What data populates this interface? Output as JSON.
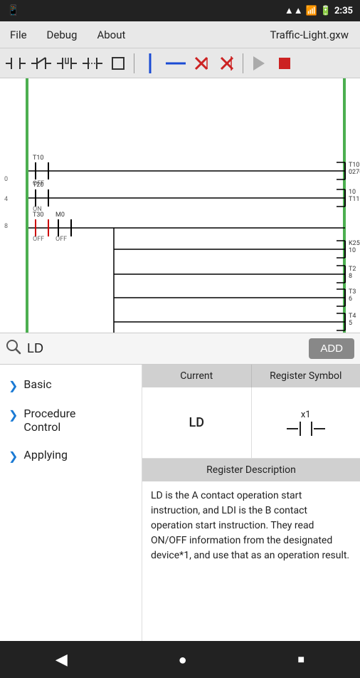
{
  "status_bar": {
    "time": "2:35",
    "battery_icon": "🔋",
    "signal_icon": "📶"
  },
  "menu_bar": {
    "items": [
      "File",
      "Debug",
      "About"
    ],
    "title": "Traffic-Light.gxw"
  },
  "toolbar": {
    "buttons": [
      {
        "name": "contact-no",
        "symbol": "⊣⊢",
        "label": "normally-open contact"
      },
      {
        "name": "contact-nc",
        "symbol": "⊣/⊢",
        "label": "normally-closed contact"
      },
      {
        "name": "contact-p",
        "symbol": "⊣↑⊢",
        "label": "positive pulse contact"
      },
      {
        "name": "contact-n",
        "symbol": "⊣↓⊢",
        "label": "negative pulse contact"
      },
      {
        "name": "box-symbol",
        "symbol": "[]",
        "label": "box"
      },
      {
        "name": "vertical-line",
        "symbol": "|",
        "label": "vertical line"
      },
      {
        "name": "horizontal-line",
        "symbol": "—",
        "label": "horizontal line"
      },
      {
        "name": "delete-x1",
        "symbol": "✕",
        "label": "delete 1"
      },
      {
        "name": "delete-x2",
        "symbol": "✕",
        "label": "delete 2"
      },
      {
        "name": "play",
        "symbol": "▶",
        "label": "play"
      },
      {
        "name": "stop",
        "symbol": "■",
        "label": "stop"
      }
    ]
  },
  "search": {
    "value": "LD",
    "placeholder": "Search",
    "add_label": "ADD"
  },
  "categories": [
    {
      "id": "basic",
      "label": "Basic",
      "active": false
    },
    {
      "id": "procedure-control",
      "label": "Procedure Control",
      "active": true
    },
    {
      "id": "applying",
      "label": "Applying",
      "active": false
    }
  ],
  "register_panel": {
    "headers": [
      "Current",
      "Register Symbol"
    ],
    "current_value": "LD",
    "symbol_x_label": "x1",
    "description_header": "Register Description",
    "description": "LD is the A contact operation start instruction, and LDI is the B contact operation start instruction. They read ON/OFF information from the designated device*1, and use that as an operation result."
  },
  "nav_bar": {
    "back_label": "◀",
    "home_label": "●",
    "square_label": "■"
  }
}
